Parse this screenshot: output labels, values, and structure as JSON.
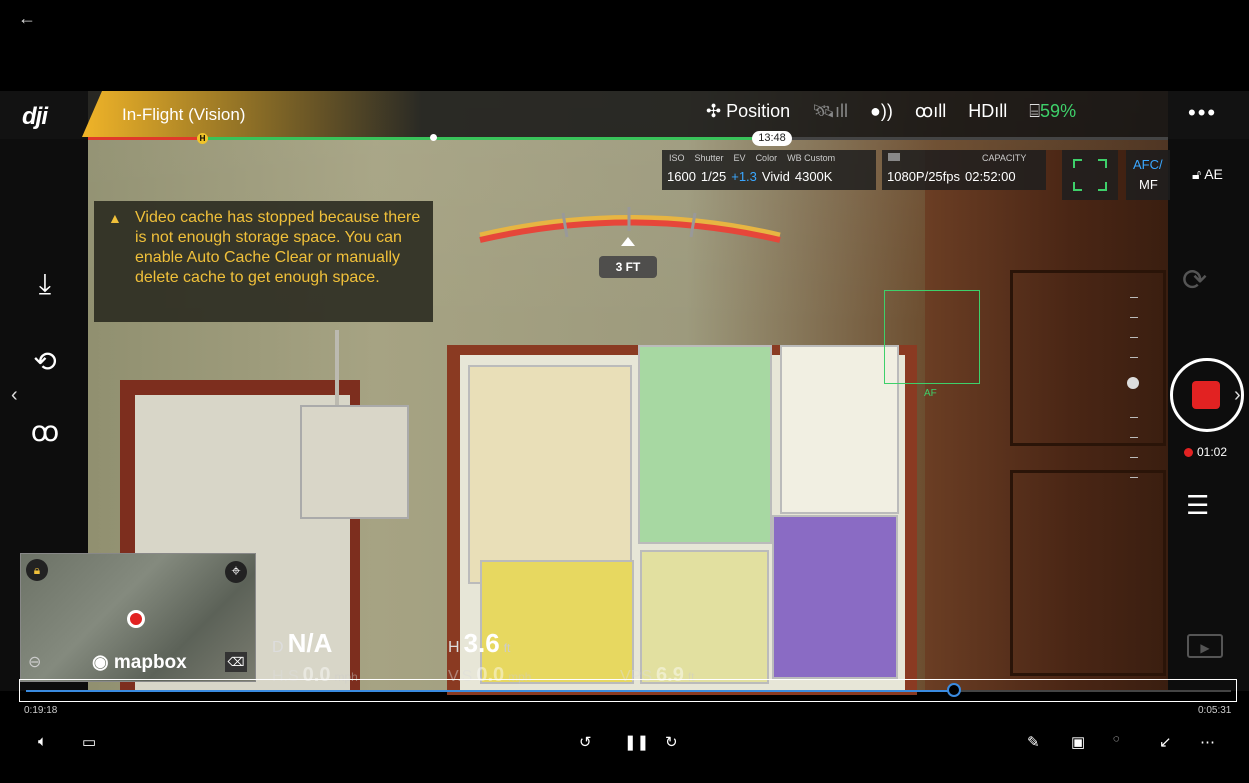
{
  "window": {
    "back_glyph": "←"
  },
  "topbar": {
    "brand": "dji",
    "mode": "In-Flight (Vision)",
    "flight_mode": "Position",
    "battery": "59%",
    "more_glyph": "•••",
    "flight_time": "13:48",
    "h_marker": "H"
  },
  "camera_params": {
    "iso_label": "ISO",
    "iso": "1600",
    "shutter_label": "Shutter",
    "shutter": "1/25",
    "ev_label": "EV",
    "ev": "+1.3",
    "color_label": "Color",
    "color": "Vivid",
    "wb_label": "WB Custom",
    "wb": "4300K",
    "capacity_label": "CAPACITY",
    "resolution": "1080P/25fps",
    "capacity": "02:52:00",
    "afc_label": "AFC/",
    "mf_label": "MF",
    "ae_label": "AE"
  },
  "warning": {
    "text": "Video cache has stopped because there is not enough storage space. You can enable Auto Cache Clear or manually delete cache to get enough space."
  },
  "obstacle": {
    "distance": "3 FT"
  },
  "focus": {
    "af_label": "AF"
  },
  "recording": {
    "time": "01:02"
  },
  "telemetry": {
    "d_label": "D",
    "d_value": "N/A",
    "h_label": "H",
    "h_value": "3.6",
    "h_unit": "ft",
    "hs_label": "H.S",
    "hs_value": "0.0",
    "hs_unit": "mph",
    "vs_label": "V.S",
    "vs_value": "0.0",
    "vs_unit": "mph",
    "vps_label": "VPS",
    "vps_value": "6.9",
    "vps_unit": "ft"
  },
  "map": {
    "logo_text": "mapbox"
  },
  "player": {
    "elapsed": "0:19:18",
    "remaining": "0:05:31",
    "progress": 0.77
  }
}
